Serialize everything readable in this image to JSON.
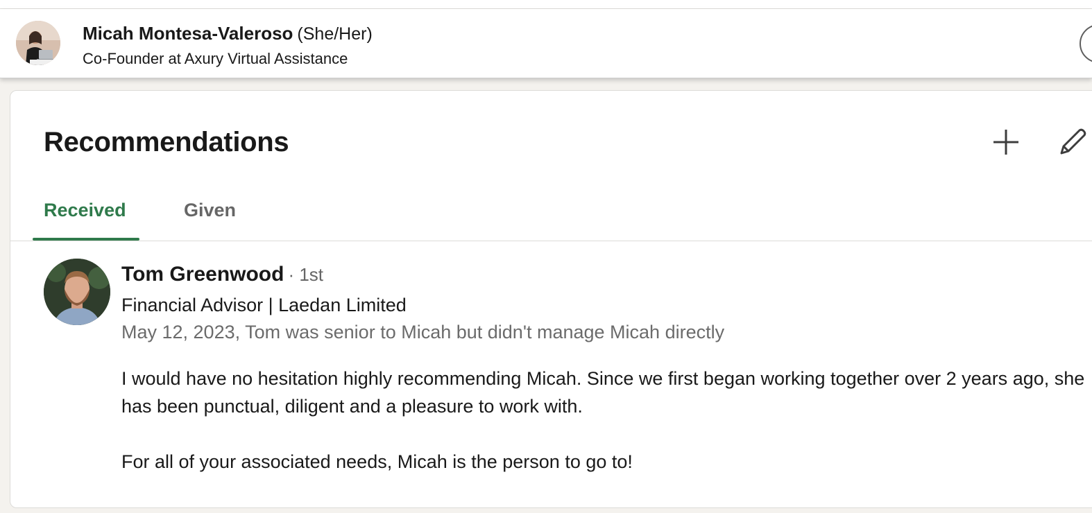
{
  "profile_header": {
    "name": "Micah Montesa-Valeroso",
    "pronouns": "(She/Her)",
    "headline": "Co-Founder at Axury Virtual Assistance"
  },
  "section": {
    "title": "Recommendations",
    "add_icon": "plus-icon",
    "edit_icon": "pencil-icon"
  },
  "tabs": [
    {
      "label": "Received",
      "active": true
    },
    {
      "label": "Given",
      "active": false
    }
  ],
  "recommendation": {
    "name": "Tom Greenwood",
    "degree": "· 1st",
    "title": "Financial Advisor | Laedan Limited",
    "meta": "May 12, 2023, Tom was senior to Micah but didn't manage Micah directly",
    "paragraphs": [
      "I would have no hesitation highly recommending Micah. Since we first began working together over 2 years ago, she has been punctual, diligent and a pleasure to work with.",
      "For all of your associated needs, Micah is the person to go to!"
    ]
  },
  "colors": {
    "accent": "#2f7a4b",
    "text_primary": "#191919",
    "text_secondary": "#666666",
    "background": "#f4f2ee"
  }
}
